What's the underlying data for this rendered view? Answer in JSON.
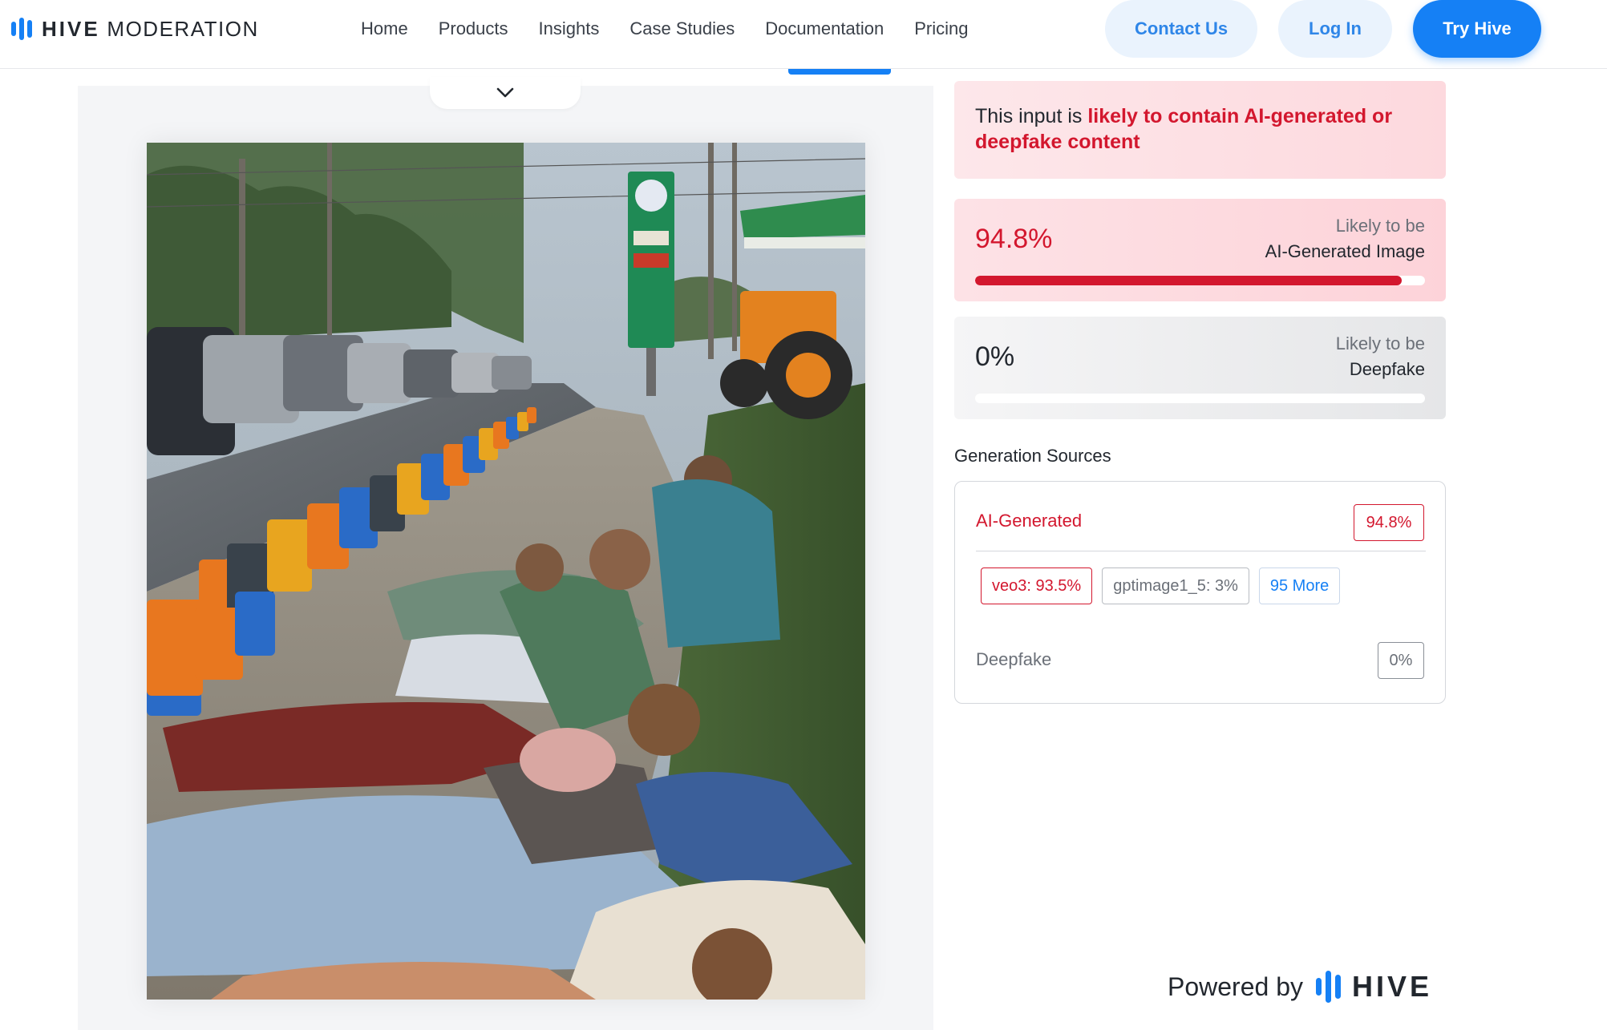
{
  "header": {
    "logo_bold": "HIVE",
    "logo_light": "MODERATION",
    "nav": [
      "Home",
      "Products",
      "Insights",
      "Case Studies",
      "Documentation",
      "Pricing"
    ],
    "contact_label": "Contact Us",
    "login_label": "Log In",
    "try_label": "Try Hive"
  },
  "image_panel": {
    "collapse_icon": "chevron-down-icon",
    "image_alt": "Photo of people lying on blankets beside a road next to a long row of fuel jerry cans at a gas station"
  },
  "verdict": {
    "prefix": "This input is ",
    "highlight": "likely to contain AI-generated or deepfake content"
  },
  "scores": {
    "ai": {
      "value": "94.8%",
      "fraction": 0.948,
      "line1": "Likely to be",
      "line2": "AI-Generated Image"
    },
    "deepfake": {
      "value": "0%",
      "fraction": 0.0,
      "line1": "Likely to be",
      "line2": "Deepfake"
    }
  },
  "sources": {
    "title": "Generation Sources",
    "ai_label": "AI-Generated",
    "ai_value": "94.8%",
    "chips": {
      "veo": "veo3: 93.5%",
      "gpt": "gptimage1_5: 3%",
      "more": "95 More"
    },
    "deepfake_label": "Deepfake",
    "deepfake_value": "0%"
  },
  "footer": {
    "powered_by": "Powered by",
    "brand": "HIVE"
  },
  "colors": {
    "brand_blue": "#1580f5",
    "alert_red": "#d3172e"
  }
}
